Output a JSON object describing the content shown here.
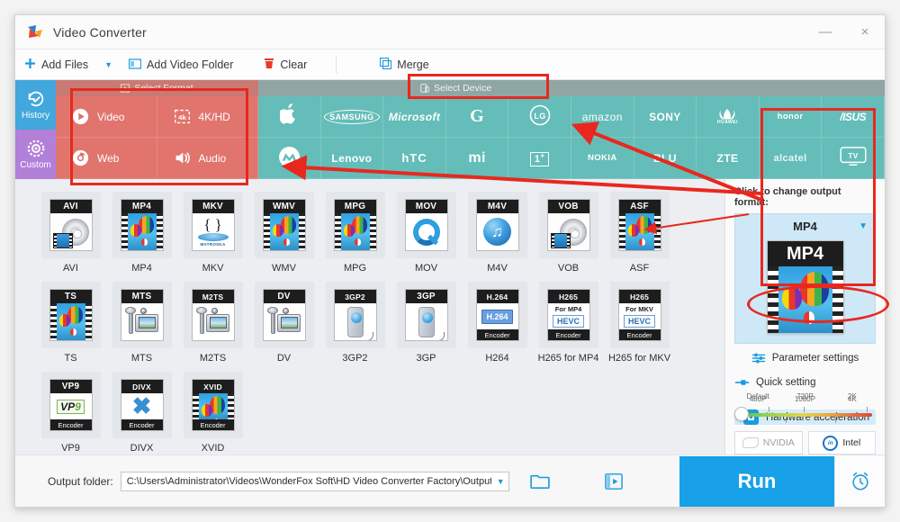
{
  "window": {
    "title": "Video Converter",
    "minimize": "—",
    "close": "×"
  },
  "toolbar": {
    "add_files": "Add Files",
    "caret": "▼",
    "add_video_folder": "Add Video Folder",
    "clear": "Clear",
    "merge": "Merge"
  },
  "sidebar": {
    "history": "History",
    "custom": "Custom"
  },
  "band": {
    "select_format_header": "Select Format",
    "select_device_header": "Select Device",
    "categories": [
      {
        "label": "Video",
        "icon": "play-circle-icon"
      },
      {
        "label": "4K/HD",
        "icon": "4k-icon"
      },
      {
        "label": "Web",
        "icon": "chrome-icon"
      },
      {
        "label": "Audio",
        "icon": "speaker-icon"
      }
    ],
    "brands": [
      {
        "label": "",
        "style": "apple"
      },
      {
        "label": "SAMSUNG",
        "style": "samsung"
      },
      {
        "label": "Microsoft",
        "style": "microsoft"
      },
      {
        "label": "G",
        "style": "google"
      },
      {
        "label": "LG",
        "style": "lg"
      },
      {
        "label": "amazon",
        "style": "amazon"
      },
      {
        "label": "SONY",
        "style": "sony"
      },
      {
        "label": "HUAWEI",
        "style": "huawei"
      },
      {
        "label": "honor",
        "style": "honor"
      },
      {
        "label": "/ISUS",
        "style": "asus"
      },
      {
        "label": "M",
        "style": "motorola"
      },
      {
        "label": "Lenovo",
        "style": "lenovo"
      },
      {
        "label": "hTC",
        "style": "htc"
      },
      {
        "label": "mi",
        "style": "xiaomi"
      },
      {
        "label": "1+",
        "style": "oneplus"
      },
      {
        "label": "NOKIA",
        "style": "nokia"
      },
      {
        "label": "BLU",
        "style": "blu"
      },
      {
        "label": "ZTE",
        "style": "zte"
      },
      {
        "label": "alcatel",
        "style": "alcatel"
      },
      {
        "label": "TV",
        "style": "tv"
      }
    ]
  },
  "formats": [
    {
      "label": "AVI",
      "cap": "AVI",
      "art": "disc",
      "foot": ""
    },
    {
      "label": "MP4",
      "cap": "MP4",
      "art": "balloon",
      "foot": ""
    },
    {
      "label": "MKV",
      "cap": "MKV",
      "art": "matroska",
      "foot": ""
    },
    {
      "label": "WMV",
      "cap": "WMV",
      "art": "balloon",
      "foot": ""
    },
    {
      "label": "MPG",
      "cap": "MPG",
      "art": "balloon",
      "foot": ""
    },
    {
      "label": "MOV",
      "cap": "MOV",
      "art": "qt",
      "foot": ""
    },
    {
      "label": "M4V",
      "cap": "M4V",
      "art": "note",
      "foot": ""
    },
    {
      "label": "VOB",
      "cap": "VOB",
      "art": "disc",
      "foot": ""
    },
    {
      "label": "ASF",
      "cap": "ASF",
      "art": "balloon",
      "foot": ""
    },
    {
      "label": "TS",
      "cap": "TS",
      "art": "balloon",
      "foot": ""
    },
    {
      "label": "MTS",
      "cap": "MTS",
      "art": "cam",
      "foot": ""
    },
    {
      "label": "M2TS",
      "cap": "M2TS",
      "art": "cam",
      "foot": ""
    },
    {
      "label": "DV",
      "cap": "DV",
      "art": "cam",
      "foot": ""
    },
    {
      "label": "3GP2",
      "cap": "3GP2",
      "art": "phone",
      "foot": ""
    },
    {
      "label": "3GP",
      "cap": "3GP",
      "art": "phone",
      "foot": ""
    },
    {
      "label": "H264",
      "cap": "H.264",
      "art": "enc264",
      "foot": "Encoder",
      "badge": "H.264"
    },
    {
      "label": "H265 for MP4",
      "cap": "H265",
      "art": "hevc",
      "foot": "Encoder",
      "for": "For MP4",
      "box": "HEVC"
    },
    {
      "label": "H265 for MKV",
      "cap": "H265",
      "art": "hevc",
      "foot": "Encoder",
      "for": "For MKV",
      "box": "HEVC"
    },
    {
      "label": "VP9",
      "cap": "VP9",
      "art": "vp9",
      "foot": "Encoder",
      "box": "VP9"
    },
    {
      "label": "DIVX",
      "cap": "DIVX",
      "art": "divx",
      "foot": "Encoder"
    },
    {
      "label": "XVID",
      "cap": "XVID",
      "art": "balloon",
      "foot": "Encoder"
    }
  ],
  "right_panel": {
    "title": "Click to change output format:",
    "output_format": "MP4",
    "caret": "▼",
    "preview_cap": "MP4",
    "parameter_settings": "Parameter settings",
    "quick_setting": "Quick setting",
    "slider": {
      "top_labels": [
        "480P",
        "1080P",
        "4K"
      ],
      "bottom_labels": [
        "Default",
        "720P",
        "2K"
      ],
      "value": "Default"
    },
    "hardware_acceleration": "Hardware acceleration",
    "gpu_nvidia": "NVIDIA",
    "gpu_intel": "Intel"
  },
  "bottom": {
    "output_folder_label": "Output folder:",
    "output_folder_path": "C:\\Users\\Administrator\\Videos\\WonderFox Soft\\HD Video Converter Factory\\OutputVideo\\",
    "caret": "▼",
    "run": "Run"
  },
  "colors": {
    "accent_blue": "#18a0e8",
    "format_red": "#e06f68",
    "device_teal": "#64bdb8",
    "history_blue": "#41a7dc",
    "custom_purple": "#b27fd9",
    "annotation_red": "#e8281e"
  }
}
